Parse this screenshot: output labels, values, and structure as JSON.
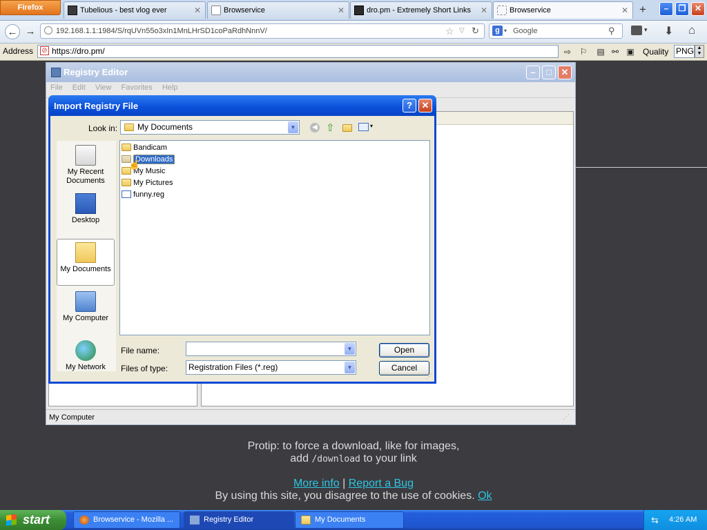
{
  "browser": {
    "menu_label": "Firefox",
    "tabs": [
      {
        "title": "Tubelious - best vlog ever",
        "active": false
      },
      {
        "title": "Browservice",
        "active": false
      },
      {
        "title": "dro.pm - Extremely Short Links",
        "active": false
      },
      {
        "title": "Browservice",
        "active": true
      }
    ],
    "new_tab_label": "+",
    "url": "192.168.1.1:1984/S/rqUVn55o3xIn1MnLHrSD1coPaRdhNnnV/",
    "search_engine": "Google",
    "search_placeholder": "Google"
  },
  "address_bar": {
    "label": "Address",
    "url": "https://dro.pm/",
    "quality_label": "Quality",
    "quality_value": "PNG"
  },
  "registry_editor": {
    "title": "Registry Editor",
    "menu": [
      "File",
      "Edit",
      "View",
      "Favorites",
      "Help"
    ],
    "status": "My Computer"
  },
  "import_dialog": {
    "title": "Import Registry File",
    "look_in_label": "Look in:",
    "look_in_value": "My Documents",
    "places": [
      {
        "label": "My Recent Documents",
        "selected": false
      },
      {
        "label": "Desktop",
        "selected": false
      },
      {
        "label": "My Documents",
        "selected": true
      },
      {
        "label": "My Computer",
        "selected": false
      },
      {
        "label": "My Network",
        "selected": false
      }
    ],
    "files": [
      {
        "name": "Bandicam",
        "kind": "folder",
        "selected": false
      },
      {
        "name": "Downloads",
        "kind": "folder",
        "selected": true
      },
      {
        "name": "My Music",
        "kind": "folder",
        "selected": false
      },
      {
        "name": "My Pictures",
        "kind": "folder",
        "selected": false
      },
      {
        "name": "funny.reg",
        "kind": "reg",
        "selected": false
      }
    ],
    "file_name_label": "File name:",
    "file_name_value": "",
    "file_type_label": "Files of type:",
    "file_type_value": "Registration Files (*.reg)",
    "open_label": "Open",
    "cancel_label": "Cancel"
  },
  "page": {
    "protip_line1": "Protip: to force a download, like for images,",
    "protip_prefix": "add",
    "protip_code": "/download",
    "protip_suffix": "to your link",
    "more_info": "More info",
    "separator": "|",
    "report_bug": "Report a Bug",
    "cookie_text": "By using this site, you disagree to the use of cookies.",
    "ok_link": "Ok"
  },
  "taskbar": {
    "start_label": "start",
    "tasks": [
      {
        "label": "Browservice - Mozilla ...",
        "active": false
      },
      {
        "label": "Registry Editor",
        "active": true
      },
      {
        "label": "My Documents",
        "active": false
      }
    ],
    "clock": "4:26 AM"
  },
  "colors": {
    "xp_title_blue": "#0a4fd9",
    "link_cyan": "#2ec6e0",
    "page_background": "#3b3b40",
    "taskbar_blue": "#245edb",
    "start_green": "#3c8e34"
  }
}
